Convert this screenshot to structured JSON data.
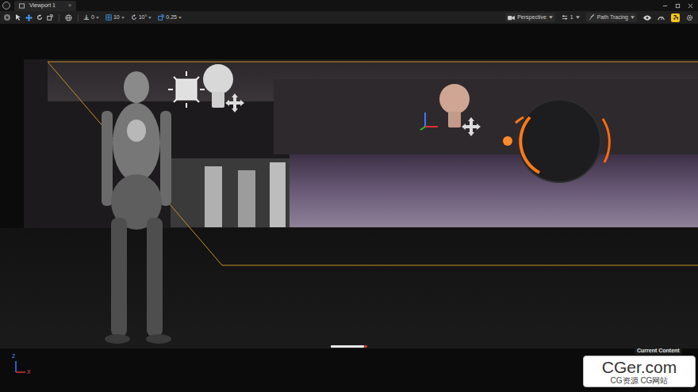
{
  "window": {
    "tab": {
      "label": "Viewport 1",
      "close": "×"
    }
  },
  "toolbar": {
    "snaps": [
      {
        "label": "0"
      },
      {
        "label": "10"
      },
      {
        "label": "10°"
      },
      {
        "label": "0.25"
      }
    ],
    "view_mode": "Perspective",
    "camera_speed": "1",
    "render_mode": "Path Tracing",
    "lock_active": true
  },
  "render_progress": {
    "level": 0.92
  },
  "axis": {
    "z": "Z",
    "x": "X"
  },
  "content_browser": {
    "label": "Current Content"
  },
  "watermark": {
    "title": "CGer.com",
    "subtitle": "CG资源 CG网站"
  }
}
